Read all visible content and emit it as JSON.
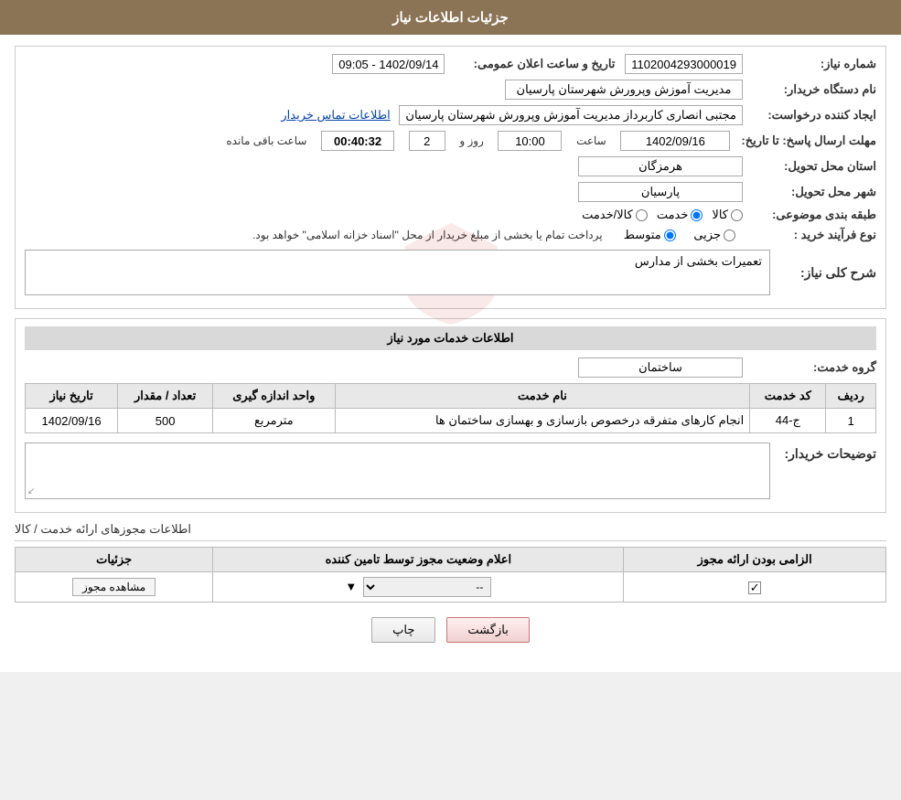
{
  "page": {
    "title": "جزئیات اطلاعات نیاز"
  },
  "fields": {
    "need_number_label": "شماره نیاز:",
    "need_number_value": "1102004293000019",
    "announce_datetime_label": "تاریخ و ساعت اعلان عمومی:",
    "announce_datetime_value": "1402/09/14 - 09:05",
    "buyer_org_label": "نام دستگاه خریدار:",
    "buyer_org_value": "مدیریت آموزش وپرورش شهرستان پارسیان",
    "requester_label": "ایجاد کننده درخواست:",
    "requester_value": "مجتبی انصاری کاربرداز مدیریت آموزش وپرورش شهرستان پارسیان",
    "contact_link": "اطلاعات تماس خریدار",
    "deadline_label": "مهلت ارسال پاسخ: تا تاریخ:",
    "deadline_date": "1402/09/16",
    "deadline_time_label": "ساعت",
    "deadline_time": "10:00",
    "deadline_days_label": "روز و",
    "deadline_days": "2",
    "deadline_timer_label": "ساعت باقی مانده",
    "deadline_timer": "00:40:32",
    "province_label": "استان محل تحویل:",
    "province_value": "هرمزگان",
    "city_label": "شهر محل تحویل:",
    "city_value": "پارسیان",
    "category_label": "طبقه بندی موضوعی:",
    "category_options": [
      "کالا",
      "خدمت",
      "کالا/خدمت"
    ],
    "category_selected": "خدمت",
    "process_label": "نوع فرآیند خرید :",
    "process_options": [
      "جزیی",
      "متوسط"
    ],
    "process_note": "پرداخت تمام یا بخشی از مبلغ خریدار از محل \"اسناد خزانه اسلامی\" خواهد بود.",
    "description_label": "شرح کلی نیاز:",
    "description_value": "تعمیرات بخشی از مدارس",
    "services_section_title": "اطلاعات خدمات مورد نیاز",
    "service_group_label": "گروه خدمت:",
    "service_group_value": "ساختمان",
    "table": {
      "headers": [
        "ردیف",
        "کد خدمت",
        "نام خدمت",
        "واحد اندازه گیری",
        "تعداد / مقدار",
        "تاریخ نیاز"
      ],
      "rows": [
        {
          "row": "1",
          "code": "ج-44",
          "name": "انجام کارهای متفرقه درخصوص بازسازی و بهسازی ساختمان ها",
          "unit": "مترمربع",
          "quantity": "500",
          "date": "1402/09/16"
        }
      ]
    },
    "buyer_notes_label": "توضیحات خریدار:",
    "permissions_title": "اطلاعات مجوزهای ارائه خدمت / کالا",
    "perm_table": {
      "headers": [
        "الزامی بودن ارائه مجوز",
        "اعلام وضعیت مجوز توسط تامین کننده",
        "جزئیات"
      ],
      "rows": [
        {
          "mandatory": "checked",
          "status": "--",
          "details": "مشاهده مجوز"
        }
      ]
    },
    "btn_print": "چاپ",
    "btn_back": "بازگشت"
  }
}
